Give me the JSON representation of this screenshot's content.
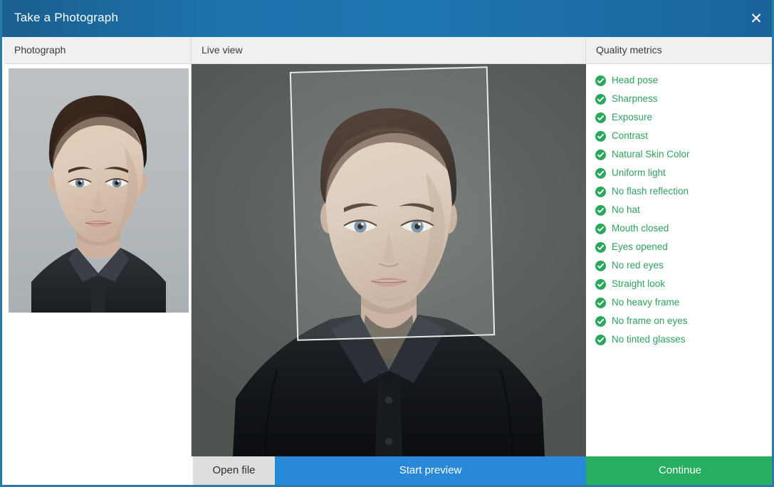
{
  "window": {
    "title": "Take a Photograph",
    "close_icon": "close-icon",
    "close_glyph": "✕"
  },
  "colors": {
    "titlebar_blue": "#1d74ad",
    "window_border": "#2a7ca8",
    "accent_blue": "#2789d8",
    "accent_green": "#27ae60",
    "metric_text_green": "#2ea25c",
    "header_gray": "#eff0f1",
    "openfile_gray": "#dcdedf"
  },
  "panels": {
    "photograph": {
      "header": "Photograph",
      "image_alt": "passport portrait of a woman with dark hair pulled back, wearing a dark shirt, on a light gray background"
    },
    "live_view": {
      "header": "Live view",
      "image_alt": "live camera view of a woman facing the camera on a dark gray background",
      "overlay": "crop-frame-overlay"
    },
    "quality_metrics": {
      "header": "Quality metrics",
      "items": [
        {
          "label": "Head pose",
          "status": "pass",
          "icon": "check-circle-icon"
        },
        {
          "label": "Sharpness",
          "status": "pass",
          "icon": "check-circle-icon"
        },
        {
          "label": "Exposure",
          "status": "pass",
          "icon": "check-circle-icon"
        },
        {
          "label": "Contrast",
          "status": "pass",
          "icon": "check-circle-icon"
        },
        {
          "label": "Natural Skin Color",
          "status": "pass",
          "icon": "check-circle-icon"
        },
        {
          "label": "Uniform light",
          "status": "pass",
          "icon": "check-circle-icon"
        },
        {
          "label": "No flash reflection",
          "status": "pass",
          "icon": "check-circle-icon"
        },
        {
          "label": "No hat",
          "status": "pass",
          "icon": "check-circle-icon"
        },
        {
          "label": "Mouth closed",
          "status": "pass",
          "icon": "check-circle-icon"
        },
        {
          "label": "Eyes opened",
          "status": "pass",
          "icon": "check-circle-icon"
        },
        {
          "label": "No red eyes",
          "status": "pass",
          "icon": "check-circle-icon"
        },
        {
          "label": "Straight look",
          "status": "pass",
          "icon": "check-circle-icon"
        },
        {
          "label": "No heavy frame",
          "status": "pass",
          "icon": "check-circle-icon"
        },
        {
          "label": "No frame on eyes",
          "status": "pass",
          "icon": "check-circle-icon"
        },
        {
          "label": "No tinted glasses",
          "status": "pass",
          "icon": "check-circle-icon"
        }
      ]
    }
  },
  "buttons": {
    "open_file": "Open file",
    "start_preview": "Start preview",
    "continue": "Continue"
  }
}
